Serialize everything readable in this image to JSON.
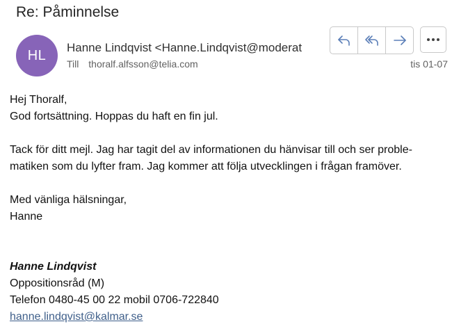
{
  "email": {
    "subject": "Re: Påminnelse",
    "avatar_initials": "HL",
    "avatar_color": "#8764b8",
    "from": "Hanne Lindqvist <Hanne.Lindqvist@moderat",
    "to_label": "Till",
    "to": "thoralf.alfsson@telia.com",
    "date": "tis 01-07"
  },
  "actions": {
    "reply_icon": "reply-icon",
    "reply_all_icon": "reply-all-icon",
    "forward_icon": "forward-icon",
    "more_icon": "more-icon",
    "accent": "#5b7fb8"
  },
  "body": {
    "greeting": "Hej Thoralf,",
    "line1": "God fortsättning. Hoppas du haft en fin jul.",
    "para2_line1": "Tack för ditt mejl. Jag har tagit del av informationen du hänvisar till och ser proble-",
    "para2_line2": "matiken som du lyfter fram. Jag kommer att följa utvecklingen i frågan framöver.",
    "closing": "Med vänliga hälsningar,",
    "sender_first": "Hanne"
  },
  "signature": {
    "name": "Hanne Lindqvist",
    "title": "Oppositionsråd (M)",
    "phone": "Telefon 0480-45 00 22 mobil 0706-722840",
    "email_link": "hanne.lindqvist@kalmar.se"
  }
}
